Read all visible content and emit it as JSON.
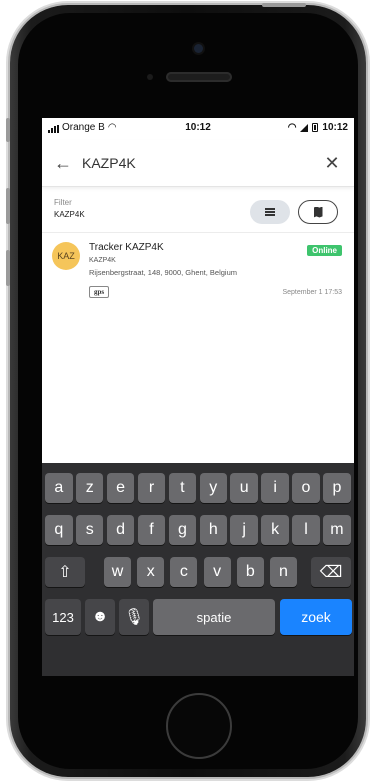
{
  "status_bar": {
    "carrier": "Orange B",
    "time_center": "10:12",
    "time_right": "10:12"
  },
  "search": {
    "query": "KAZP4K",
    "back_icon": "arrow-left-icon",
    "clear_icon": "close-icon"
  },
  "filter": {
    "label": "Filter",
    "value": "KAZP4K",
    "views": [
      "list-icon",
      "map-icon"
    ]
  },
  "tracker": {
    "avatar": "KAZ",
    "title": "Tracker KAZP4K",
    "subtitle": "KAZP4K",
    "address": "Rijsenbergstraat, 148, 9000, Ghent, Belgium",
    "status": "Online",
    "tag": "gps",
    "date": "September 1 17:53",
    "colors": {
      "status": "#3ec46d",
      "avatar": "#f5c55a"
    }
  },
  "keyboard": {
    "row1": [
      "a",
      "z",
      "e",
      "r",
      "t",
      "y",
      "u",
      "i",
      "o",
      "p"
    ],
    "row2": [
      "q",
      "s",
      "d",
      "f",
      "g",
      "h",
      "j",
      "k",
      "l",
      "m"
    ],
    "row3": [
      "w",
      "x",
      "c",
      "v",
      "b",
      "n"
    ],
    "numbers": "123",
    "space": "spatie",
    "go": "zoek",
    "colors": {
      "go": "#1a84ff"
    }
  }
}
